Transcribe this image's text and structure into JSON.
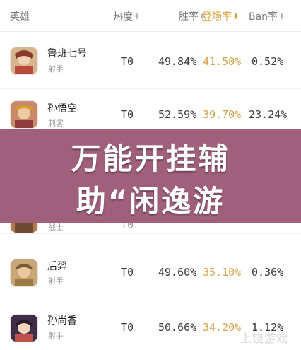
{
  "header": {
    "hero": "英雄",
    "heat": "热度",
    "win_rate": "胜率",
    "pick_rate": "登场率",
    "ban_rate": "Ban率"
  },
  "rows": [
    {
      "name": "鲁班七号",
      "role": "射手",
      "tier": "T0",
      "win": "49.84%",
      "pick": "41.50%",
      "ban": "0.52%",
      "avatar_icon": "hero-avatar-icon"
    },
    {
      "name": "孙悟空",
      "role": "刺客",
      "tier": "T0",
      "win": "52.59%",
      "pick": "39.70%",
      "ban": "23.24%",
      "avatar_icon": "hero-avatar-icon"
    },
    {
      "name": "",
      "role": "战士",
      "tier": "T0",
      "win": "",
      "pick": "",
      "ban": "",
      "avatar_icon": "hero-avatar-icon"
    },
    {
      "name": "后羿",
      "role": "射手",
      "tier": "T0",
      "win": "49.60%",
      "pick": "35.10%",
      "ban": "0.36%",
      "avatar_icon": "hero-avatar-icon"
    },
    {
      "name": "孙尚香",
      "role": "射手",
      "tier": "T0",
      "win": "50.66%",
      "pick": "34.20%",
      "ban": "1.12%",
      "avatar_icon": "hero-avatar-icon"
    }
  ],
  "overlay": {
    "line1": "万能开挂辅",
    "line2": "助“闲逸游"
  },
  "watermark": "上饶游戏",
  "colors": {
    "accent": "#d9a441",
    "overlay": "#a0607c"
  }
}
